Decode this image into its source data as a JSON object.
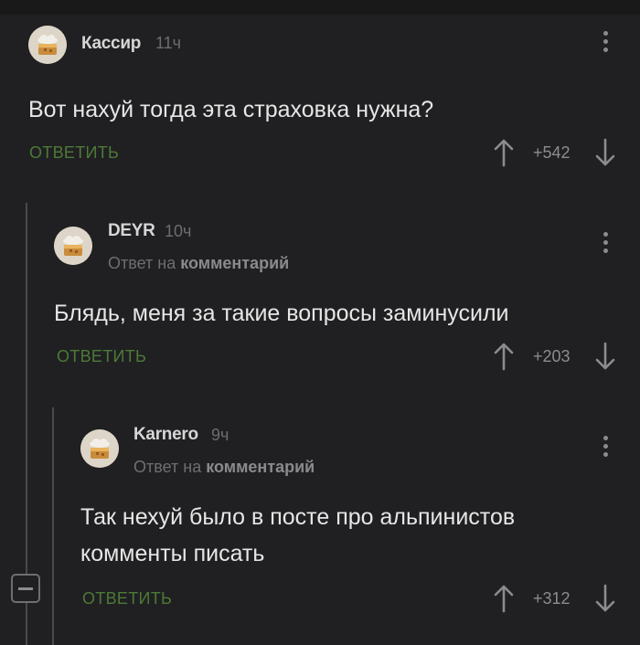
{
  "comments": [
    {
      "author": "Кассир",
      "time": "11ч",
      "text": "Вот нахуй тогда эта страховка нужна?",
      "reply_label": "ОТВЕТИТЬ",
      "rating": "+542"
    },
    {
      "author": "DEYR",
      "time": "10ч",
      "reply_prefix": "Ответ на",
      "reply_target": "комментарий",
      "text": "Блядь, меня за такие вопросы заминусили",
      "reply_label": "ОТВЕТИТЬ",
      "rating": "+203"
    },
    {
      "author": "Karnero",
      "time": "9ч",
      "reply_prefix": "Ответ на",
      "reply_target": "комментарий",
      "text_lines": [
        "Так нехуй было в посте про альпинистов",
        "комменты писать"
      ],
      "reply_label": "ОТВЕТИТЬ",
      "rating": "+312"
    }
  ],
  "colors": {
    "background": "#202022",
    "reply_green": "#4d7a37",
    "text": "#e6e6e6",
    "muted": "#6d6d70"
  },
  "icons": [
    "avatar-cake-icon",
    "more-vertical-icon",
    "upvote-arrow-icon",
    "downvote-arrow-icon",
    "collapse-minus-icon"
  ]
}
